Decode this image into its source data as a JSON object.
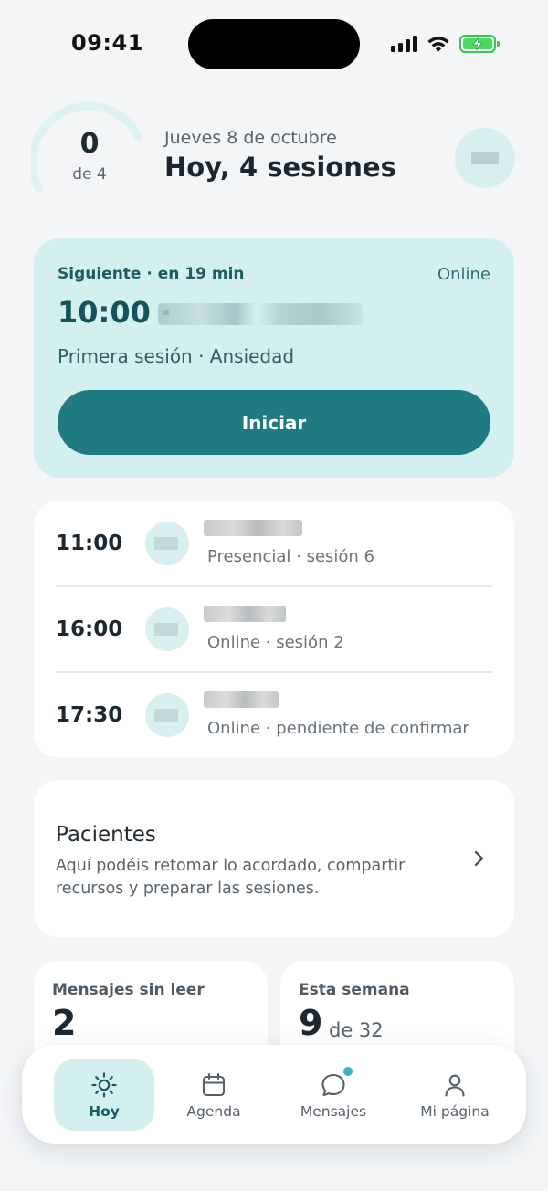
{
  "status_bar": {
    "time": "09:41"
  },
  "header": {
    "progress": {
      "done": "0",
      "total_label": "de 4",
      "fraction": 0.0
    },
    "date": "Jueves 8 de octubre",
    "title": "Hoy, 4 sesiones"
  },
  "next_session": {
    "label": "Siguiente · en 19 min",
    "mode": "Online",
    "time": "10:00 ·",
    "description": "Primera sesión · Ansiedad",
    "start_label": "Iniciar"
  },
  "schedule": [
    {
      "time": "11:00",
      "detail": "Presencial · sesión 6"
    },
    {
      "time": "16:00",
      "detail": "Online · sesión 2"
    },
    {
      "time": "17:30",
      "detail": "Online · pendiente de confirmar"
    }
  ],
  "patients": {
    "title": "Pacientes",
    "description": "Aquí podéis retomar lo acordado, compartir recursos y preparar las sesiones."
  },
  "stats": {
    "unread": {
      "label": "Mensajes sin leer",
      "value": "2"
    },
    "week": {
      "label": "Esta semana",
      "value": "9",
      "sub": "de 32"
    }
  },
  "tabs": [
    {
      "label": "Hoy",
      "icon": "sun-icon",
      "active": true
    },
    {
      "label": "Agenda",
      "icon": "calendar-icon",
      "active": false
    },
    {
      "label": "Mensajes",
      "icon": "chat-bubble-icon",
      "active": false,
      "has_badge": true
    },
    {
      "label": "Mi página",
      "icon": "user-icon",
      "active": false
    }
  ],
  "colors": {
    "accent": "#1f7b81",
    "accent_light": "#d4eff0",
    "background": "#f3f5f7",
    "badge": "#3bb3c0",
    "battery": "#4cd964"
  }
}
